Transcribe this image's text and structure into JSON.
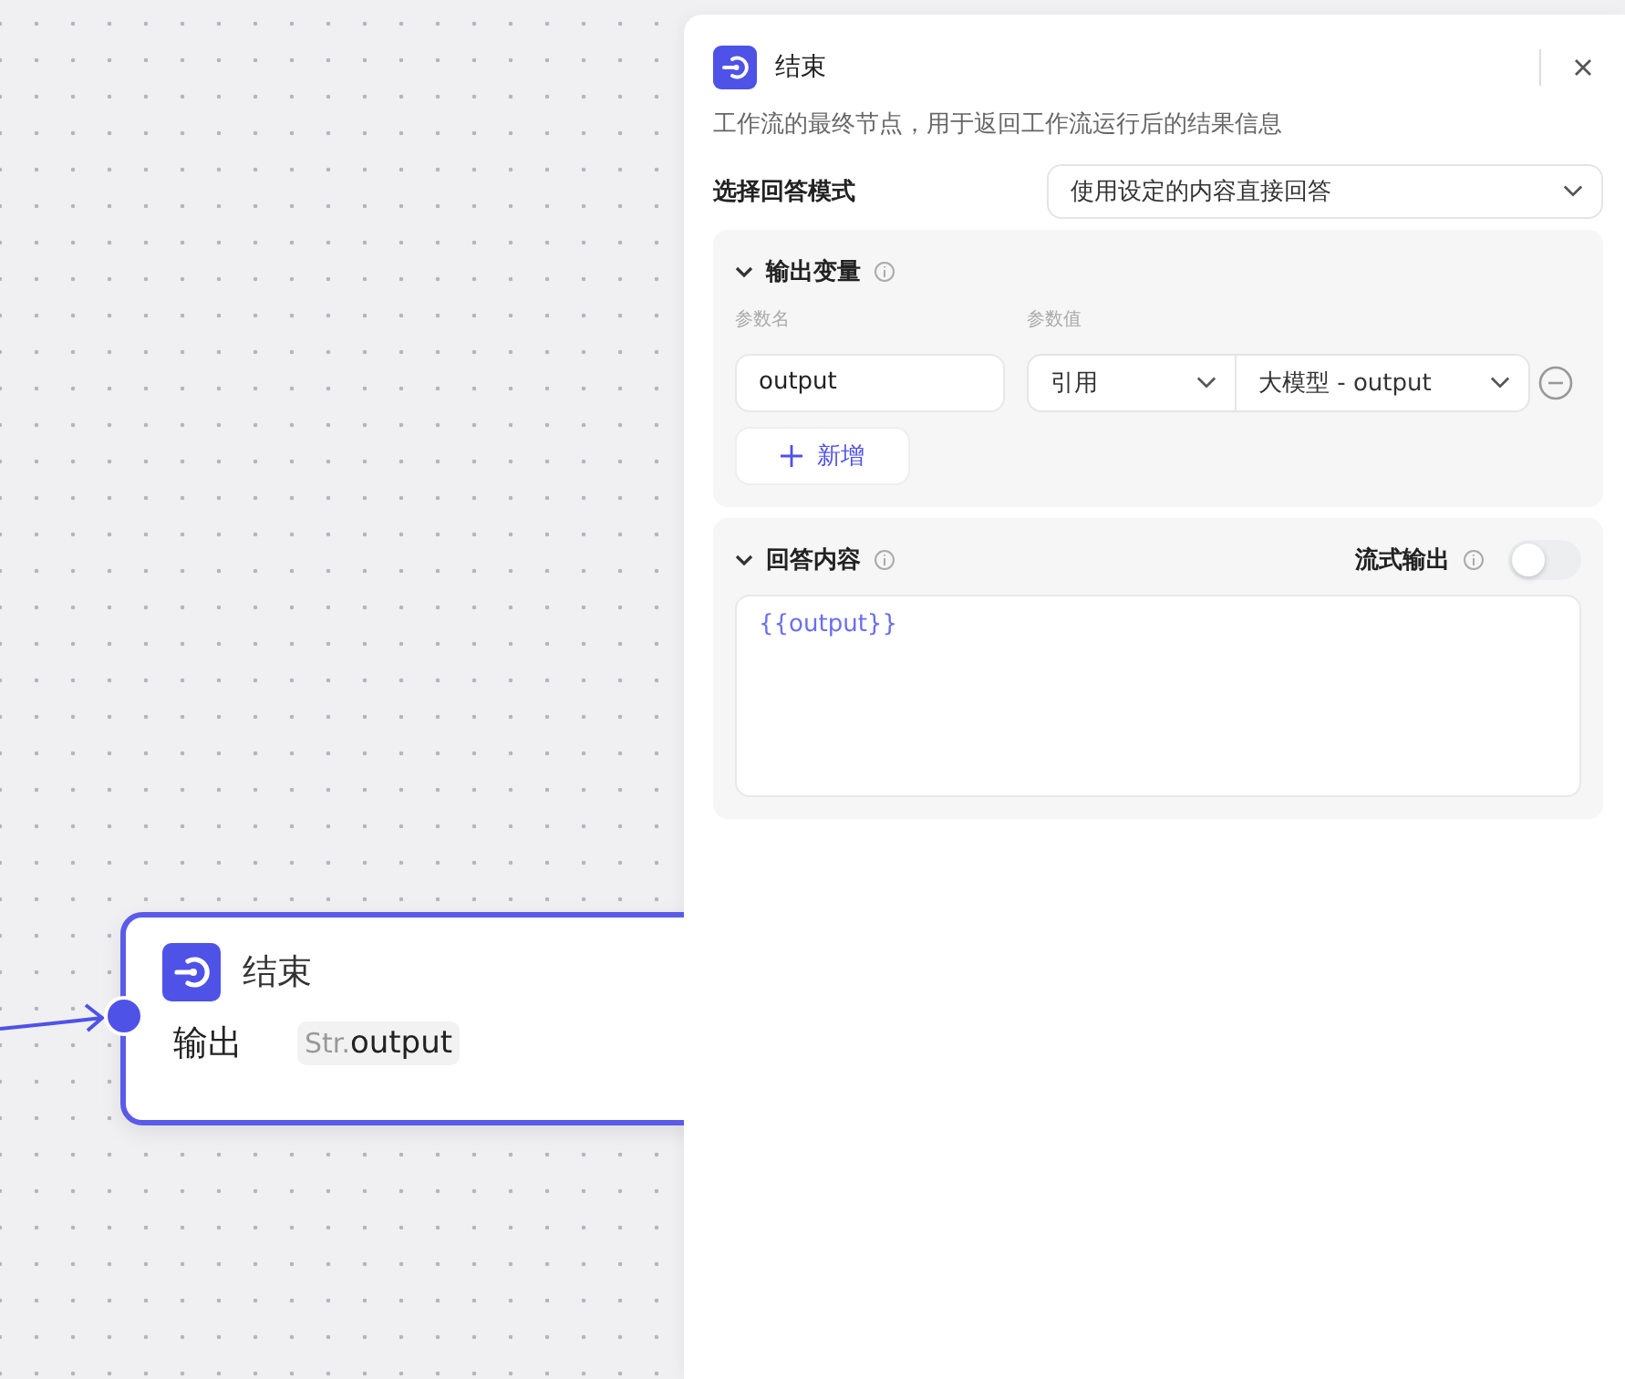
{
  "canvas": {
    "node": {
      "title": "结束",
      "output_label": "输出",
      "output_type": "Str.",
      "output_name": "output",
      "selected": true
    }
  },
  "panel": {
    "title": "结束",
    "description": "工作流的最终节点，用于返回工作流运行后的结果信息",
    "answer_mode": {
      "label": "选择回答模式",
      "value": "使用设定的内容直接回答"
    },
    "output_section": {
      "title": "输出变量",
      "expanded": true,
      "name_header": "参数名",
      "value_header": "参数值",
      "rows": [
        {
          "name": "output",
          "source": "引用",
          "value": "大模型 - output"
        }
      ],
      "add_button": "新增"
    },
    "answer_section": {
      "title": "回答内容",
      "expanded": true,
      "stream_label": "流式输出",
      "stream_on": false,
      "content": "{{output}}"
    }
  }
}
